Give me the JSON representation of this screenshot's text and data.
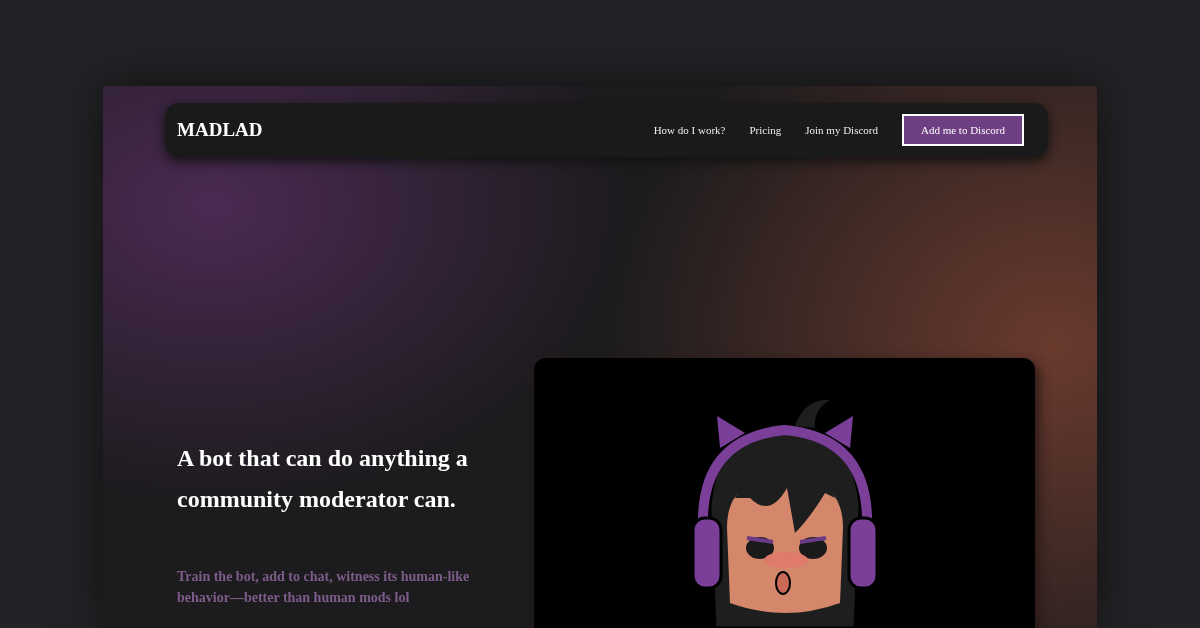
{
  "brand": "MADLAD",
  "nav": {
    "links": [
      "How do I work?",
      "Pricing",
      "Join my Discord"
    ],
    "cta": "Add me to Discord"
  },
  "hero": {
    "headline": "A bot that can do anything a community moderator can.",
    "subtitle": "Train the bot, add to chat, witness its human-like behavior—better than human mods lol"
  }
}
